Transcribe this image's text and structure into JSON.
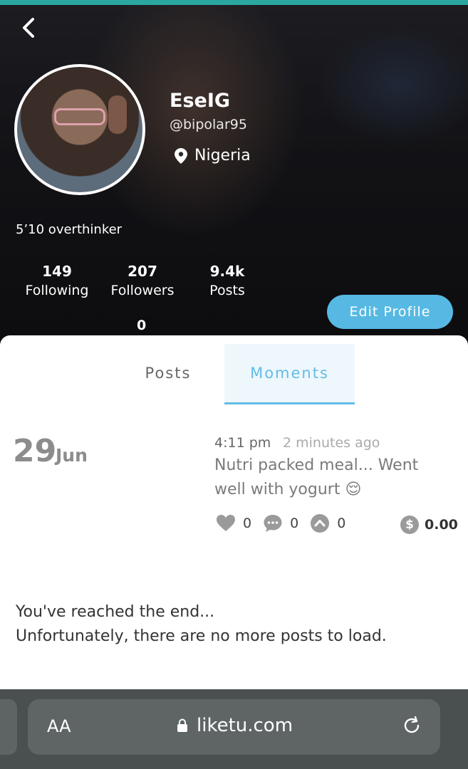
{
  "profile": {
    "name": "EseIG",
    "handle": "@bipolar95",
    "location": "Nigeria",
    "bio": "5’10 overthinker"
  },
  "stats": {
    "following": {
      "value": "149",
      "label": "Following"
    },
    "followers": {
      "value": "207",
      "label": "Followers"
    },
    "posts": {
      "value": "9.4k",
      "label": "Posts"
    },
    "extra": "0"
  },
  "edit_profile_label": "Edit Profile",
  "tabs": [
    {
      "label": "Posts",
      "active": false
    },
    {
      "label": "Moments",
      "active": true
    }
  ],
  "post": {
    "day": "29",
    "month": "Jun",
    "time": "4:11 pm",
    "ago": "2 minutes ago",
    "text": "Nutri packed meal... Went well with yogurt 😌",
    "likes": "0",
    "comments": "0",
    "upvotes": "0",
    "earnings_symbol": "$",
    "earnings": "0.00"
  },
  "end_message": {
    "line1": "You've reached the end...",
    "line2": "Unfortunately, there are no more posts to load."
  },
  "browser": {
    "text_size_label": "AA",
    "url": "liketu.com"
  },
  "colors": {
    "accent": "#57b9e3",
    "topbar": "#2aa8a0",
    "browser_bg": "#4a5050"
  },
  "icons": [
    "back-icon",
    "location-pin-icon",
    "heart-icon",
    "comment-icon",
    "upvote-icon",
    "coin-icon",
    "lock-icon",
    "reload-icon"
  ]
}
